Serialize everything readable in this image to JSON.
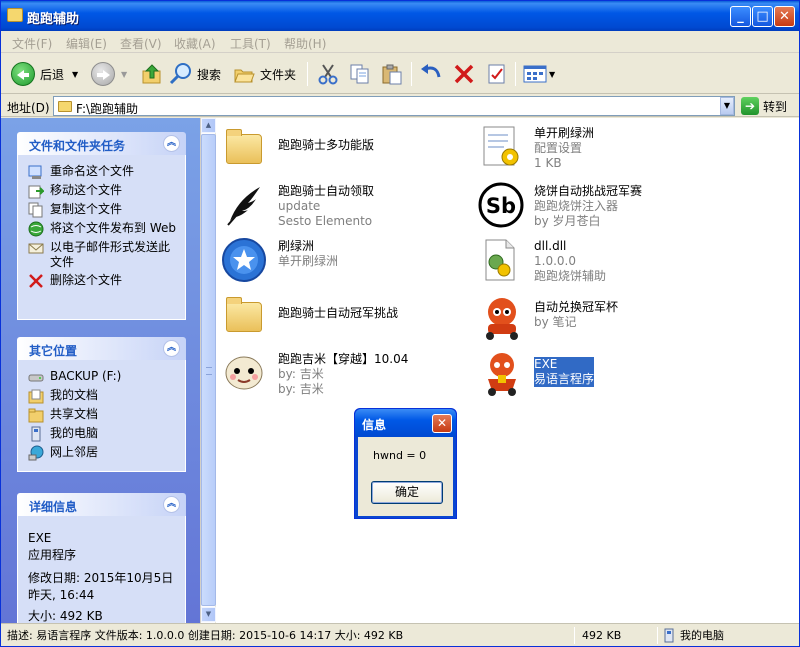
{
  "window": {
    "title": "跑跑辅助"
  },
  "menu": [
    "文件(F)",
    "编辑(E)",
    "查看(V)",
    "收藏(A)",
    "工具(T)",
    "帮助(H)"
  ],
  "toolbar": {
    "back": "后退",
    "search": "搜索",
    "folders": "文件夹"
  },
  "address": {
    "label": "地址(D)",
    "path": "F:\\跑跑辅助",
    "go": "转到"
  },
  "tasks_panel": {
    "title": "文件和文件夹任务",
    "items": [
      "重命名这个文件",
      "移动这个文件",
      "复制这个文件",
      "将这个文件发布到 Web",
      "以电子邮件形式发送此文件",
      "删除这个文件"
    ]
  },
  "places_panel": {
    "title": "其它位置",
    "items": [
      "BACKUP (F:)",
      "我的文档",
      "共享文档",
      "我的电脑",
      "网上邻居"
    ]
  },
  "details_panel": {
    "title": "详细信息",
    "name": "EXE",
    "type": "应用程序",
    "modified": "修改日期: 2015年10月5日 昨天, 16:44",
    "size": "大小: 492 KB"
  },
  "files": [
    {
      "name": "跑跑骑士多功能版",
      "line2": "",
      "line3": "",
      "icon": "folder-icon"
    },
    {
      "name": "单开刷绿洲",
      "line2": "配置设置",
      "line3": "1 KB",
      "icon": "config-file-icon"
    },
    {
      "name": "跑跑骑士自动领取",
      "line2": "update",
      "line3": "Sesto Elemento",
      "icon": "feather-icon"
    },
    {
      "name": "烧饼自动挑战冠军赛",
      "line2": "跑跑烧饼注入器",
      "line3": "by 岁月苍白",
      "icon": "sb-logo-icon"
    },
    {
      "name": "刷绿洲",
      "line2": "单开刷绿洲",
      "line3": "",
      "icon": "blue-star-icon"
    },
    {
      "name": "dll.dll",
      "line2": "1.0.0.0",
      "line3": "跑跑烧饼辅助",
      "icon": "dll-file-icon"
    },
    {
      "name": "跑跑骑士自动冠军挑战",
      "line2": "",
      "line3": "",
      "icon": "folder-icon"
    },
    {
      "name": "自动兑换冠军杯",
      "line2": "by 笔记",
      "line3": "",
      "icon": "kart-character-icon"
    },
    {
      "name": "跑跑吉米【穿越】10.04",
      "line2": "by: 吉米",
      "line3": "by: 吉米",
      "icon": "cartoon-face-icon"
    },
    {
      "name": "EXE",
      "line2": "易语言程序",
      "line3": "",
      "icon": "kart-rider-icon"
    }
  ],
  "dialog": {
    "title": "信息",
    "message": "hwnd = 0",
    "ok": "确定"
  },
  "status": {
    "description": "描述: 易语言程序 文件版本: 1.0.0.0 创建日期: 2015-10-6 14:17 大小: 492 KB",
    "size": "492 KB",
    "zone": "我的电脑"
  }
}
